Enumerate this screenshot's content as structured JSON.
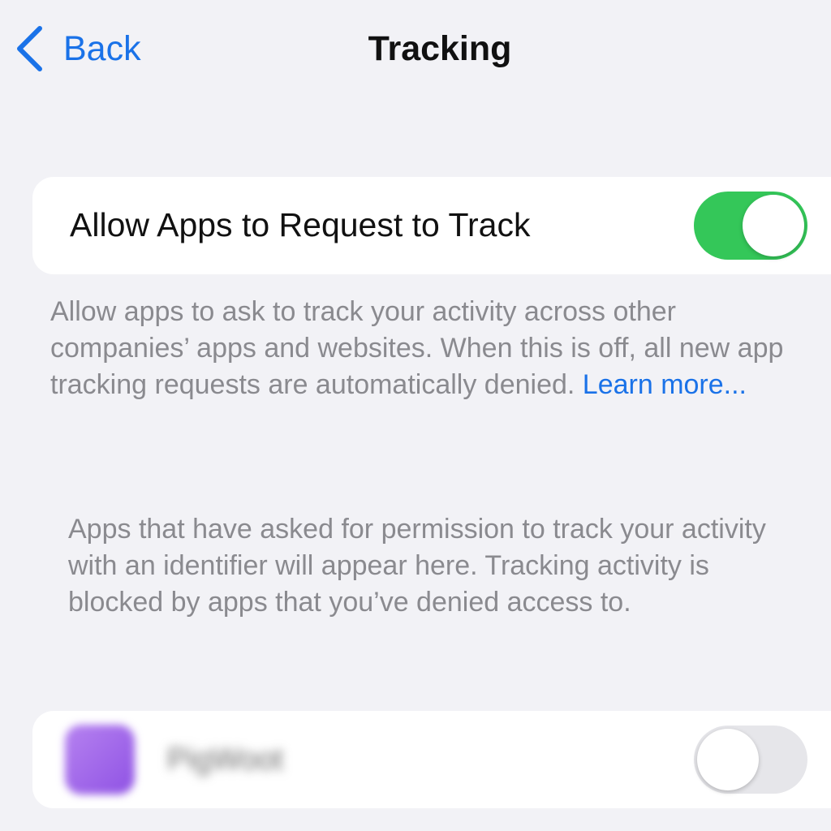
{
  "nav": {
    "back_label": "Back",
    "title": "Tracking"
  },
  "main_setting": {
    "label": "Allow Apps to Request to Track",
    "toggle_state": "on"
  },
  "footer": {
    "text": "Allow apps to ask to track your activity across other companies’ apps and websites. When this is off, all new app tracking requests are automatically denied. ",
    "learn_more": "Learn more..."
  },
  "info": {
    "text": "Apps that have asked for permission to track your activity with an identifier will appear here. Tracking activity is blocked by apps that you’ve denied access to."
  },
  "app_row": {
    "name": "PigWoot",
    "toggle_state": "off"
  },
  "colors": {
    "accent": "#1A72E8",
    "toggle_on": "#34C759",
    "toggle_off": "#E6E6EA",
    "background": "#F2F2F6"
  },
  "icons": {
    "back": "chevron-left-icon"
  }
}
